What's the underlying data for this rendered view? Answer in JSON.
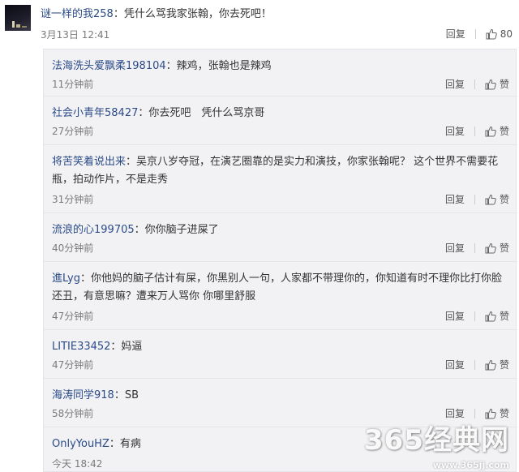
{
  "main_comment": {
    "username": "谜一样的我258",
    "text": "：凭什么骂我家张翰，你去死吧！",
    "time": "3月13日 12:41",
    "reply_label": "回复",
    "like_count": "80",
    "avatar_icon": "avatar-night-city"
  },
  "replies": [
    {
      "username": "法海洗头爱飘柔198104",
      "text": "：辣鸡，张翰也是辣鸡",
      "time": "11分钟前",
      "reply_label": "回复",
      "like_label": "赞"
    },
    {
      "username": "社会小青年58427",
      "text": "：你去死吧　凭什么骂京哥",
      "time": "27分钟前",
      "reply_label": "回复",
      "like_label": "赞"
    },
    {
      "username": "将苦笑着说出来",
      "text": "：吴京八岁夺冠，在演艺圈靠的是实力和演技，你家张翰呢？ 这个世界不需要花瓶，拍动作片，不是走秀",
      "time": "31分钟前",
      "reply_label": "回复",
      "like_label": "赞"
    },
    {
      "username": "流浪的心199705",
      "text": "：你你脑子进屎了",
      "time": "40分钟前",
      "reply_label": "回复",
      "like_label": "赞"
    },
    {
      "username": "進Lyg",
      "text": "：你他妈的脑子估计有屎，你黑别人一句，人家都不带理你的，你知道有时不理你比打你脸还丑，有意思嘛？遭来万人骂你 你哪里舒服",
      "time": "47分钟前",
      "reply_label": "回复",
      "like_label": "赞"
    },
    {
      "username": "LITIE33452",
      "text": "：妈逼",
      "time": "47分钟前",
      "reply_label": "回复",
      "like_label": "赞"
    },
    {
      "username": "海涛同学918",
      "text": "：SB",
      "time": "58分钟前",
      "reply_label": "回复",
      "like_label": "赞"
    },
    {
      "username": "OnlyYouHZ",
      "text": "：有病",
      "time": "今天 18:42",
      "reply_label": "",
      "like_label": ""
    }
  ],
  "watermark": {
    "title": "365经典网",
    "url": "www.365jj.com"
  },
  "colors": {
    "username": "#2b4b87",
    "text": "#333333",
    "time": "#7a7a7a",
    "panel_bg": "#f2f2f5"
  }
}
